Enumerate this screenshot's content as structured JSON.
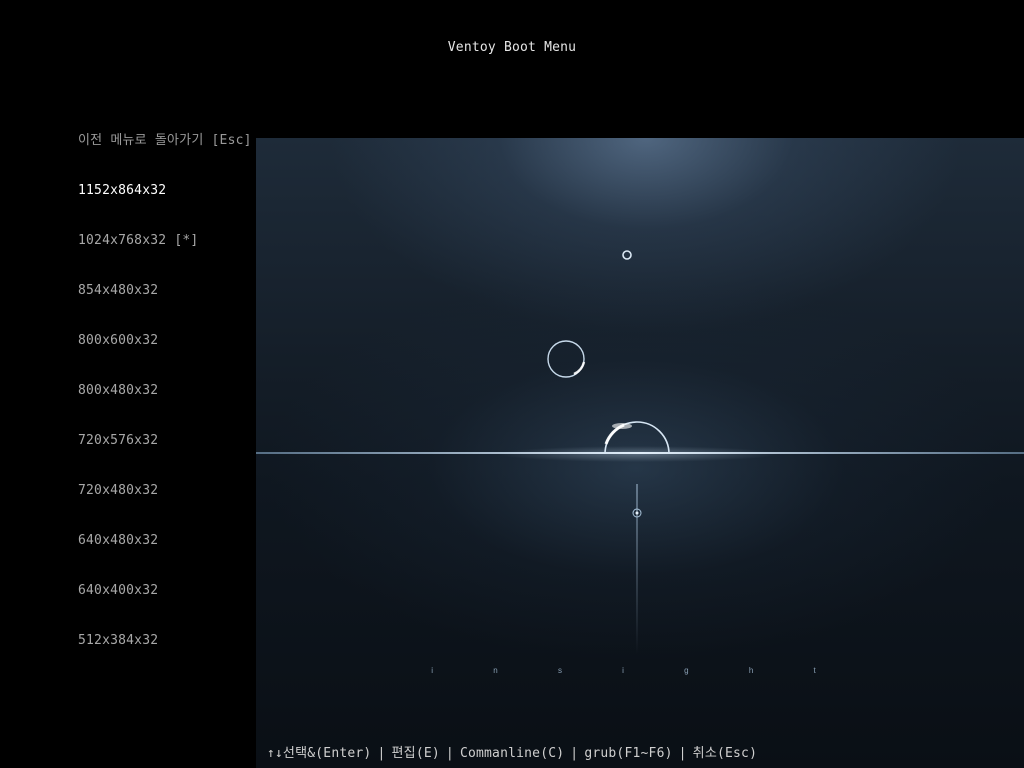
{
  "title": "Ventoy Boot Menu",
  "menu": {
    "back_label": "이전 메뉴로 돌아가기 [Esc]",
    "items": [
      {
        "label": "1152x864x32",
        "selected": true
      },
      {
        "label": "1024x768x32 [*]",
        "selected": false
      },
      {
        "label": "854x480x32",
        "selected": false
      },
      {
        "label": "800x600x32",
        "selected": false
      },
      {
        "label": "800x480x32",
        "selected": false
      },
      {
        "label": "720x576x32",
        "selected": false
      },
      {
        "label": "720x480x32",
        "selected": false
      },
      {
        "label": "640x480x32",
        "selected": false
      },
      {
        "label": "640x400x32",
        "selected": false
      },
      {
        "label": "512x384x32",
        "selected": false
      }
    ]
  },
  "footer": {
    "select_hint": "↑↓선택&(Enter)",
    "edit_hint": "편집(E)",
    "commandline_hint": "Commanline(C)",
    "grub_hint": "grub(F1~F6)",
    "cancel_hint": "취소(Esc)"
  },
  "wallpaper": {
    "text": "i n s i g h t"
  },
  "colors": {
    "background": "#000000",
    "selected_text": "#ffffff",
    "menu_text": "#a8a8a8"
  }
}
